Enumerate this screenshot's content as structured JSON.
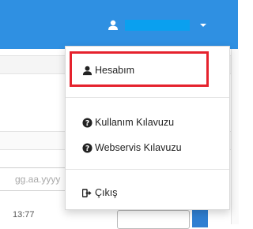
{
  "header": {
    "username_hidden": true
  },
  "page": {
    "date_placeholder": "gg.aa.yyyy",
    "time_fragment": "13:77"
  },
  "user_menu": {
    "items": [
      {
        "label": "Hesabım",
        "icon": "user-icon",
        "highlighted": true
      },
      {
        "label": "Kullanım Kılavuzu",
        "icon": "question-circle-icon"
      },
      {
        "label": "Webservis Kılavuzu",
        "icon": "question-circle-icon"
      },
      {
        "label": "Çıkış",
        "icon": "sign-out-icon"
      }
    ]
  },
  "colors": {
    "topbar": "#2f90e2",
    "redaction": "#0aa0ef",
    "highlight_border": "#e5222d"
  }
}
